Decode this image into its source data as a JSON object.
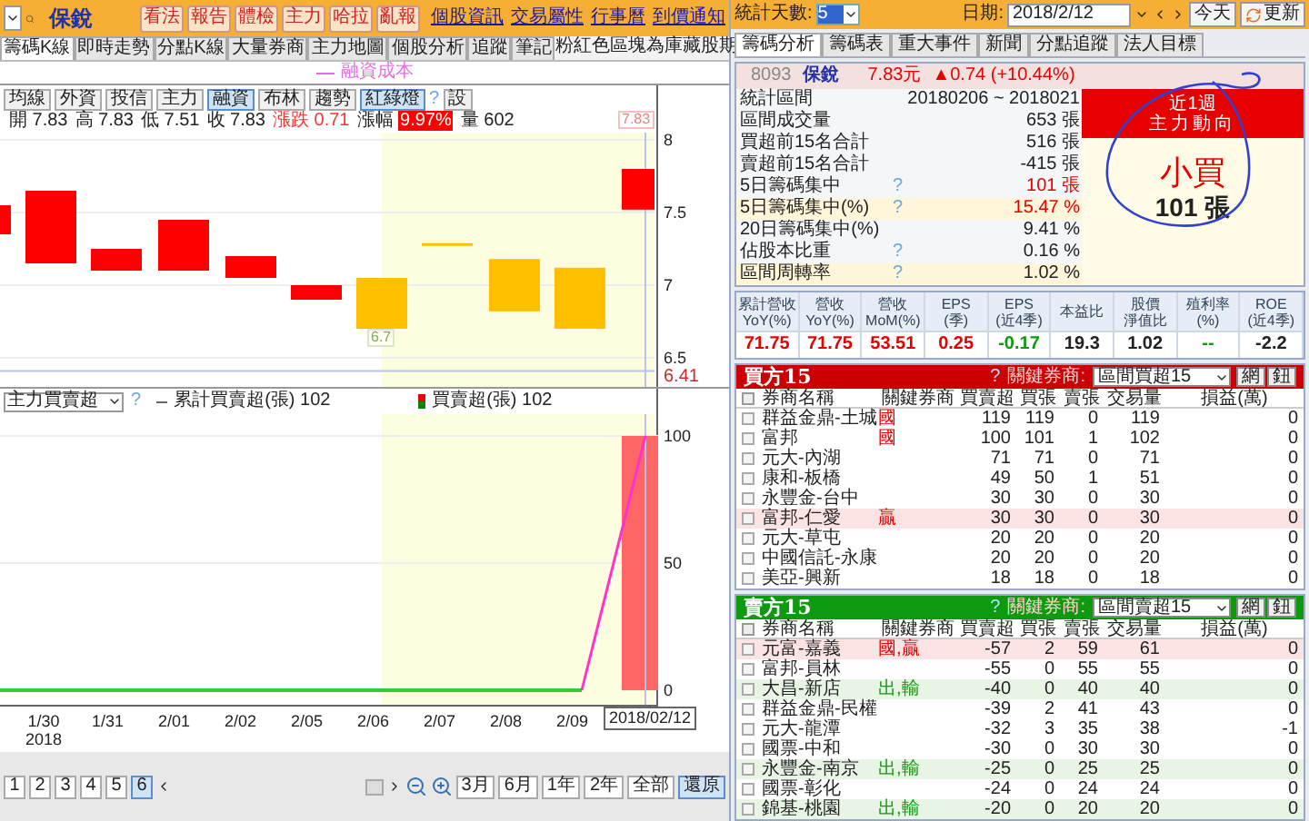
{
  "header": {
    "name": "保銳",
    "buttons": [
      "看法",
      "報告",
      "體檢",
      "主力",
      "哈拉",
      "亂報"
    ],
    "links": [
      "個股資訊",
      "交易屬性",
      "行事曆",
      "到價通知"
    ]
  },
  "tabs": [
    {
      "label": "籌碼K線",
      "selected": true
    },
    {
      "label": "即時走勢",
      "selected": false
    },
    {
      "label": "分點K線",
      "selected": false
    },
    {
      "label": "大量券商",
      "selected": false
    },
    {
      "label": "主力地圖",
      "selected": false
    },
    {
      "label": "個股分析",
      "selected": false
    },
    {
      "label": "追蹤",
      "selected": false
    },
    {
      "label": "筆記",
      "selected": false
    }
  ],
  "note": "粉紅色區塊為庫藏股期",
  "legend": "融資成本",
  "toolbar": [
    {
      "label": "均線",
      "selected": false
    },
    {
      "label": "外資",
      "selected": false
    },
    {
      "label": "投信",
      "selected": false
    },
    {
      "label": "主力",
      "selected": false
    },
    {
      "label": "融資",
      "selected": true
    },
    {
      "label": "布林",
      "selected": false
    },
    {
      "label": "趨勢",
      "selected": false
    },
    {
      "label": "紅綠燈",
      "selected": true
    }
  ],
  "toolbar_help": "?",
  "toolbar_settings": "設",
  "quote": [
    {
      "label": "開",
      "value": "7.83",
      "kind": "plain"
    },
    {
      "label": "高",
      "value": "7.83",
      "kind": "plain"
    },
    {
      "label": "低",
      "value": "7.51",
      "kind": "plain"
    },
    {
      "label": "收",
      "value": "7.83",
      "kind": "plain"
    },
    {
      "label": "漲跌",
      "value": "0.71",
      "kind": "up"
    },
    {
      "label": "漲幅",
      "value": "9.97%",
      "kind": "badge"
    },
    {
      "label": "量",
      "value": "602",
      "kind": "plain"
    }
  ],
  "price_axis": [
    "8",
    "7.5",
    "7",
    "6.5"
  ],
  "price_last": "6.41",
  "high_marker": "7.83",
  "low_marker": "6.7",
  "indicator": {
    "select": "主力買賣超",
    "help": "?",
    "cumulative": "累計買賣超(張) 102",
    "daily": "買賣超(張) 102",
    "axis": [
      "100",
      "50",
      "0"
    ]
  },
  "dates": [
    {
      "label": "1/30",
      "year": "2018"
    },
    {
      "label": "1/31"
    },
    {
      "label": "2/01"
    },
    {
      "label": "2/02"
    },
    {
      "label": "2/05"
    },
    {
      "label": "2/06"
    },
    {
      "label": "2/07"
    },
    {
      "label": "2/08"
    },
    {
      "label": "2/09"
    }
  ],
  "cursor_date": "2018/02/12",
  "pages": [
    {
      "label": "1",
      "selected": false
    },
    {
      "label": "2",
      "selected": false
    },
    {
      "label": "3",
      "selected": false
    },
    {
      "label": "4",
      "selected": false
    },
    {
      "label": "5",
      "selected": false
    },
    {
      "label": "6",
      "selected": true
    }
  ],
  "ranges": [
    {
      "label": "3月",
      "selected": false
    },
    {
      "label": "6月",
      "selected": false
    },
    {
      "label": "1年",
      "selected": false
    },
    {
      "label": "2年",
      "selected": false
    },
    {
      "label": "全部",
      "selected": false
    },
    {
      "label": "還原",
      "selected": true
    }
  ],
  "stats_bar": {
    "days_label": "統計天數:",
    "days": "5",
    "date_label": "日期:",
    "date": "2018/2/12",
    "today": "今天",
    "refresh": "更新"
  },
  "right_tabs": [
    {
      "label": "籌碼分析",
      "selected": true
    },
    {
      "label": "籌碼表",
      "selected": false
    },
    {
      "label": "重大事件",
      "selected": false
    },
    {
      "label": "新聞",
      "selected": false
    },
    {
      "label": "分點追蹤",
      "selected": false
    },
    {
      "label": "法人目標",
      "selected": false
    }
  ],
  "summary": {
    "code": "8093",
    "name": "保銳",
    "price": "7.83元",
    "change": "▲0.74 (+10.44%)"
  },
  "stats": [
    {
      "label": "統計區間",
      "value": "20180206 ~ 2018021",
      "kind": "plain",
      "highlight": false
    },
    {
      "label": "區間成交量",
      "value": "653 張",
      "kind": "plain",
      "highlight": false
    },
    {
      "label": "買超前15名合計",
      "value": "516 張",
      "kind": "plain",
      "highlight": false
    },
    {
      "label": "賣超前15名合計",
      "value": "-415 張",
      "kind": "plain",
      "highlight": false
    },
    {
      "label": "5日籌碼集中",
      "help": "?",
      "value": "101 張",
      "kind": "up",
      "highlight": false
    },
    {
      "label": "5日籌碼集中(%)",
      "help": "?",
      "value": "15.47 %",
      "kind": "up",
      "highlight": true
    },
    {
      "label": "20日籌碼集中(%)",
      "value": "9.41 %",
      "kind": "plain",
      "highlight": false
    },
    {
      "label": "佔股本比重",
      "help": "?",
      "value": "0.16 %",
      "kind": "plain",
      "highlight": false
    },
    {
      "label": "區間周轉率",
      "help": "?",
      "value": "1.02 %",
      "kind": "plain",
      "highlight": true
    }
  ],
  "trend": {
    "title": "近1週",
    "subtitle": "主力動向",
    "verdict": "小買",
    "amount": "101 張"
  },
  "financials": [
    {
      "label": "累計營收",
      "sub": "YoY(%)",
      "value": "71.75",
      "kind": "up"
    },
    {
      "label": "營收",
      "sub": "YoY(%)",
      "value": "71.75",
      "kind": "up"
    },
    {
      "label": "營收",
      "sub": "MoM(%)",
      "value": "53.51",
      "kind": "up"
    },
    {
      "label": "EPS",
      "sub": "(季)",
      "value": "0.25",
      "kind": "up"
    },
    {
      "label": "EPS",
      "sub": "(近4季)",
      "value": "-0.17",
      "kind": "down"
    },
    {
      "label": "本益比",
      "value": "19.3",
      "kind": "plain"
    },
    {
      "label": "股價",
      "sub": "淨值比",
      "value": "1.02",
      "kind": "plain"
    },
    {
      "label": "殖利率",
      "sub": "(%)",
      "value": "--",
      "kind": "down"
    },
    {
      "label": "ROE",
      "sub": "(近4季)",
      "value": "-2.2",
      "kind": "plain"
    }
  ],
  "buy": {
    "title": "買方15",
    "help": "?",
    "key_label": "關鍵券商:",
    "select": "區間買超15",
    "buttons": [
      "網",
      "鈕"
    ],
    "all_checked": false,
    "columns": [
      "券商名稱",
      "關鍵券商",
      "買賣超",
      "買張",
      "賣張",
      "交易量",
      "損益(萬)"
    ],
    "rows": [
      {
        "checked": false,
        "kind": "plain",
        "color": "#e60000",
        "cells": [
          "群益金鼎-土城",
          "國",
          "119",
          "119",
          "0",
          "119",
          "0"
        ]
      },
      {
        "checked": false,
        "kind": "plain",
        "color": "#e60000",
        "cells": [
          "富邦",
          "國",
          "100",
          "101",
          "1",
          "102",
          "0"
        ]
      },
      {
        "checked": false,
        "kind": "plain",
        "cells": [
          "元大-內湖",
          "",
          "71",
          "71",
          "0",
          "71",
          "0"
        ]
      },
      {
        "checked": false,
        "kind": "plain",
        "cells": [
          "康和-板橋",
          "",
          "49",
          "50",
          "1",
          "51",
          "0"
        ]
      },
      {
        "checked": false,
        "kind": "plain",
        "cells": [
          "永豐金-台中",
          "",
          "30",
          "30",
          "0",
          "30",
          "0"
        ]
      },
      {
        "checked": false,
        "kind": "up",
        "color": "#e60000",
        "cells": [
          "富邦-仁愛",
          "贏",
          "30",
          "30",
          "0",
          "30",
          "0"
        ]
      },
      {
        "checked": false,
        "kind": "plain",
        "cells": [
          "元大-草屯",
          "",
          "20",
          "20",
          "0",
          "20",
          "0"
        ]
      },
      {
        "checked": false,
        "kind": "plain",
        "cells": [
          "中國信託-永康",
          "",
          "20",
          "20",
          "0",
          "20",
          "0"
        ]
      },
      {
        "checked": false,
        "kind": "plain",
        "cells": [
          "美亞-興新",
          "",
          "18",
          "18",
          "0",
          "18",
          "0"
        ]
      }
    ]
  },
  "sell": {
    "title": "賣方15",
    "help": "?",
    "key_label": "關鍵券商:",
    "select": "區間賣超15",
    "buttons": [
      "網",
      "鈕"
    ],
    "all_checked": false,
    "columns": [
      "券商名稱",
      "關鍵券商",
      "買賣超",
      "買張",
      "賣張",
      "交易量",
      "損益(萬)"
    ],
    "rows": [
      {
        "checked": false,
        "kind": "up",
        "color": "#e60000",
        "cells": [
          "元富-嘉義",
          "國,贏",
          "-57",
          "2",
          "59",
          "61",
          "0"
        ]
      },
      {
        "checked": false,
        "kind": "plain",
        "cells": [
          "富邦-員林",
          "",
          "-55",
          "0",
          "55",
          "55",
          "0"
        ]
      },
      {
        "checked": false,
        "kind": "down",
        "color": "#119911",
        "cells": [
          "大昌-新店",
          "出,輸",
          "-40",
          "0",
          "40",
          "40",
          "0"
        ]
      },
      {
        "checked": false,
        "kind": "plain",
        "cells": [
          "群益金鼎-民權",
          "",
          "-39",
          "2",
          "41",
          "43",
          "0"
        ]
      },
      {
        "checked": false,
        "kind": "plain",
        "cells": [
          "元大-龍潭",
          "",
          "-32",
          "3",
          "35",
          "38",
          "-1"
        ]
      },
      {
        "checked": false,
        "kind": "plain",
        "cells": [
          "國票-中和",
          "",
          "-30",
          "0",
          "30",
          "30",
          "0"
        ]
      },
      {
        "checked": false,
        "kind": "down",
        "color": "#119911",
        "cells": [
          "永豐金-南京",
          "出,輸",
          "-25",
          "0",
          "25",
          "25",
          "0"
        ]
      },
      {
        "checked": false,
        "kind": "plain",
        "cells": [
          "國票-彰化",
          "",
          "-24",
          "0",
          "24",
          "24",
          "0"
        ]
      },
      {
        "checked": false,
        "kind": "down",
        "color": "#119911",
        "cells": [
          "錦基-桃園",
          "出,輸",
          "-20",
          "0",
          "20",
          "20",
          "0"
        ]
      }
    ]
  }
}
